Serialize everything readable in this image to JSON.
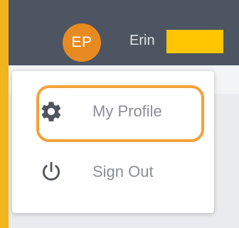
{
  "header": {
    "avatar_initials": "EP",
    "user_first_name": "Erin"
  },
  "menu": {
    "items": [
      {
        "label": "My Profile",
        "icon": "gear-icon"
      },
      {
        "label": "Sign Out",
        "icon": "power-icon"
      }
    ]
  },
  "colors": {
    "topbar": "#4c5561",
    "avatar": "#e88a22",
    "highlight": "#f3a23a",
    "page_border": "#f0b41c",
    "redaction": "#ffc500"
  }
}
